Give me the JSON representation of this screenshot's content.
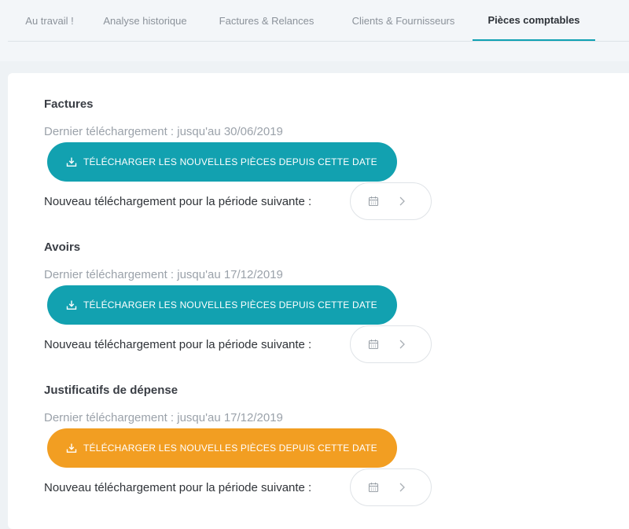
{
  "tabs": [
    {
      "label": "Au travail !"
    },
    {
      "label": "Analyse historique"
    },
    {
      "label": "Factures & Relances"
    },
    {
      "label": "Clients & Fournisseurs"
    },
    {
      "label": "Pièces comptables",
      "active": true
    }
  ],
  "sections": [
    {
      "title": "Factures",
      "last_download": "Dernier téléchargement : jusqu'au 30/06/2019",
      "button_label": "TÉLÉCHARGER LES NOUVELLES PIÈCES DEPUIS CETTE DATE",
      "button_color": "#12a1b0",
      "period_label": "Nouveau téléchargement pour la période suivante :"
    },
    {
      "title": "Avoirs",
      "last_download": "Dernier téléchargement : jusqu'au 17/12/2019",
      "button_label": "TÉLÉCHARGER LES NOUVELLES PIÈCES DEPUIS CETTE DATE",
      "button_color": "#12a1b0",
      "period_label": "Nouveau téléchargement pour la période suivante :"
    },
    {
      "title": "Justificatifs de dépense",
      "last_download": "Dernier téléchargement : jusqu'au 17/12/2019",
      "button_label": "TÉLÉCHARGER LES NOUVELLES PIÈCES DEPUIS CETTE DATE",
      "button_color": "#f29e22",
      "period_label": "Nouveau téléchargement pour la période suivante :"
    }
  ],
  "icons": {
    "download": "download-icon",
    "calendar": "calendar-icon",
    "chevron": "chevron-right-icon"
  },
  "colors": {
    "tab_active_underline": "#0fa1b3",
    "teal": "#12a1b0",
    "orange": "#f29e22"
  }
}
